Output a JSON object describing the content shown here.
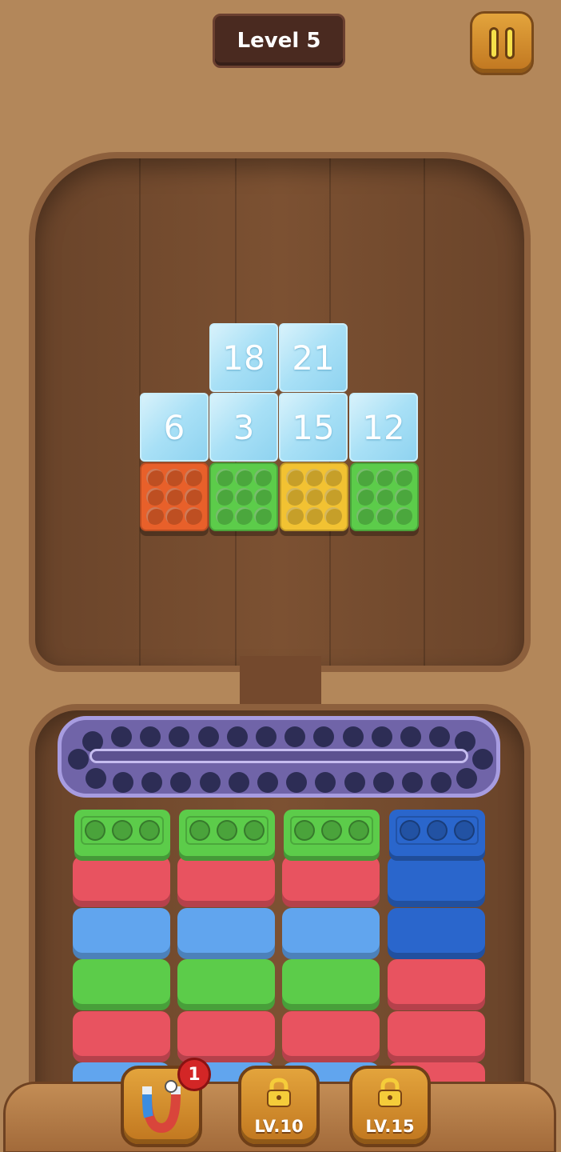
{
  "header": {
    "level_label": "Level 5"
  },
  "board": {
    "ice_tiles": [
      {
        "value": "18"
      },
      {
        "value": "21"
      },
      {
        "value": "6"
      },
      {
        "value": "3"
      },
      {
        "value": "15"
      },
      {
        "value": "12"
      }
    ],
    "color_tiles": [
      {
        "color": "orange"
      },
      {
        "color": "green"
      },
      {
        "color": "yellow"
      },
      {
        "color": "green"
      }
    ]
  },
  "stacks": [
    {
      "cap_color": "green",
      "layers": [
        "red",
        "light-blue",
        "green",
        "red",
        "light-blue"
      ]
    },
    {
      "cap_color": "green",
      "layers": [
        "red",
        "light-blue",
        "green",
        "red",
        "light-blue"
      ]
    },
    {
      "cap_color": "green",
      "layers": [
        "red",
        "light-blue",
        "green",
        "red",
        "light-blue"
      ]
    },
    {
      "cap_color": "blue",
      "layers": [
        "blue",
        "blue",
        "red",
        "red",
        "red"
      ]
    }
  ],
  "colors": {
    "red": "#e85360",
    "light_blue": "#61a5ee",
    "green": "#5ccc4a",
    "blue": "#2a66cc",
    "orange": "#e8602a",
    "yellow": "#f2c232"
  },
  "boosters": [
    {
      "icon": "magnet-icon",
      "count": "1",
      "locked": false
    },
    {
      "icon": "lock-icon",
      "label": "LV.10",
      "locked": true
    },
    {
      "icon": "lock-icon",
      "label": "LV.15",
      "locked": true
    }
  ]
}
